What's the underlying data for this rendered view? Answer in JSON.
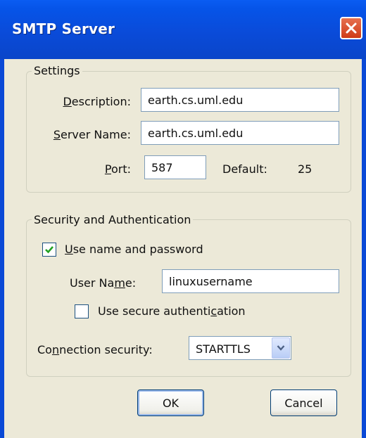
{
  "window": {
    "title": "SMTP Server"
  },
  "settings": {
    "legend": "Settings",
    "description": {
      "label_pre": "",
      "label_accel": "D",
      "label_post": "escription:",
      "value": "earth.cs.uml.edu"
    },
    "server_name": {
      "label_pre": "",
      "label_accel": "S",
      "label_post": "erver Name:",
      "value": "earth.cs.uml.edu"
    },
    "port": {
      "label_pre": "",
      "label_accel": "P",
      "label_post": "ort:",
      "value": "587",
      "default_label": "Default:",
      "default_value": "25"
    }
  },
  "security": {
    "legend": "Security and Authentication",
    "use_name_password": {
      "label_pre": "",
      "label_accel": "U",
      "label_post": "se name and password",
      "checked": true
    },
    "user_name": {
      "label_pre": "User Na",
      "label_accel": "m",
      "label_post": "e:",
      "value": "linuxusername"
    },
    "secure_auth": {
      "label_pre": "Use secure authenti",
      "label_accel": "c",
      "label_post": "ation",
      "checked": false
    },
    "connection_security": {
      "label_pre": "Co",
      "label_accel": "n",
      "label_post": "nection security:",
      "value": "STARTTLS"
    }
  },
  "buttons": {
    "ok": "OK",
    "cancel": "Cancel"
  }
}
